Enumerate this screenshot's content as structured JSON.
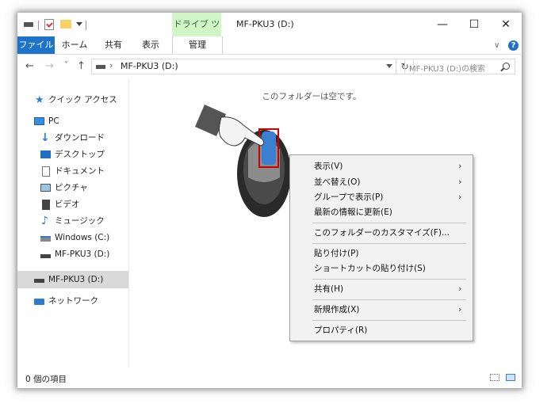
{
  "titlebar": {
    "context_tab_title": "ドライブ ツール",
    "window_title": "MF-PKU3 (D:)",
    "minimize": "—",
    "maximize": "☐",
    "close": "✕"
  },
  "ribbon": {
    "tabs": [
      "ファイル",
      "ホーム",
      "共有",
      "表示",
      "管理"
    ],
    "collapse_chevron": "∨",
    "help": "?"
  },
  "address": {
    "back": "←",
    "forward": "→",
    "recent": "˅",
    "up": "↑",
    "separator": "›",
    "path": "MF-PKU3 (D:)",
    "refresh": "↻",
    "search_placeholder": "MF-PKU3 (D:)の検索"
  },
  "sidebar": {
    "items": [
      {
        "label": "クイック アクセス",
        "icon": "quick-access-star-icon"
      },
      {
        "label": "PC",
        "icon": "pc-icon"
      },
      {
        "label": "ダウンロード",
        "icon": "download-icon"
      },
      {
        "label": "デスクトップ",
        "icon": "desktop-icon"
      },
      {
        "label": "ドキュメント",
        "icon": "document-icon"
      },
      {
        "label": "ピクチャ",
        "icon": "picture-icon"
      },
      {
        "label": "ビデオ",
        "icon": "video-icon"
      },
      {
        "label": "ミュージック",
        "icon": "music-icon"
      },
      {
        "label": "Windows (C:)",
        "icon": "windows-drive-icon"
      },
      {
        "label": "MF-PKU3 (D:)",
        "icon": "usb-drive-icon"
      },
      {
        "label": "MF-PKU3 (D:)",
        "icon": "usb-drive-icon"
      },
      {
        "label": "ネットワーク",
        "icon": "network-icon"
      }
    ]
  },
  "content": {
    "empty_message": "このフォルダーは空です。"
  },
  "status": {
    "item_count": "0 個の項目"
  },
  "context_menu": {
    "items": [
      {
        "label": "表示(V)",
        "submenu": true
      },
      {
        "label": "並べ替え(O)",
        "submenu": true
      },
      {
        "label": "グループで表示(P)",
        "submenu": true
      },
      {
        "label": "最新の情報に更新(E)",
        "submenu": false
      },
      {
        "label": "このフォルダーのカスタマイズ(F)...",
        "submenu": false
      },
      {
        "label": "貼り付け(P)",
        "submenu": false
      },
      {
        "label": "ショートカットの貼り付け(S)",
        "submenu": false
      },
      {
        "label": "共有(H)",
        "submenu": true
      },
      {
        "label": "新規作成(X)",
        "submenu": true
      },
      {
        "label": "プロパティ(R)",
        "submenu": false
      }
    ],
    "submenu_arrow": "›"
  },
  "colors": {
    "file_tab": "#1e73c8",
    "context_tab": "#d2f5c8",
    "highlight_box": "#cc0000",
    "mouse_button": "#3b7fd0"
  }
}
